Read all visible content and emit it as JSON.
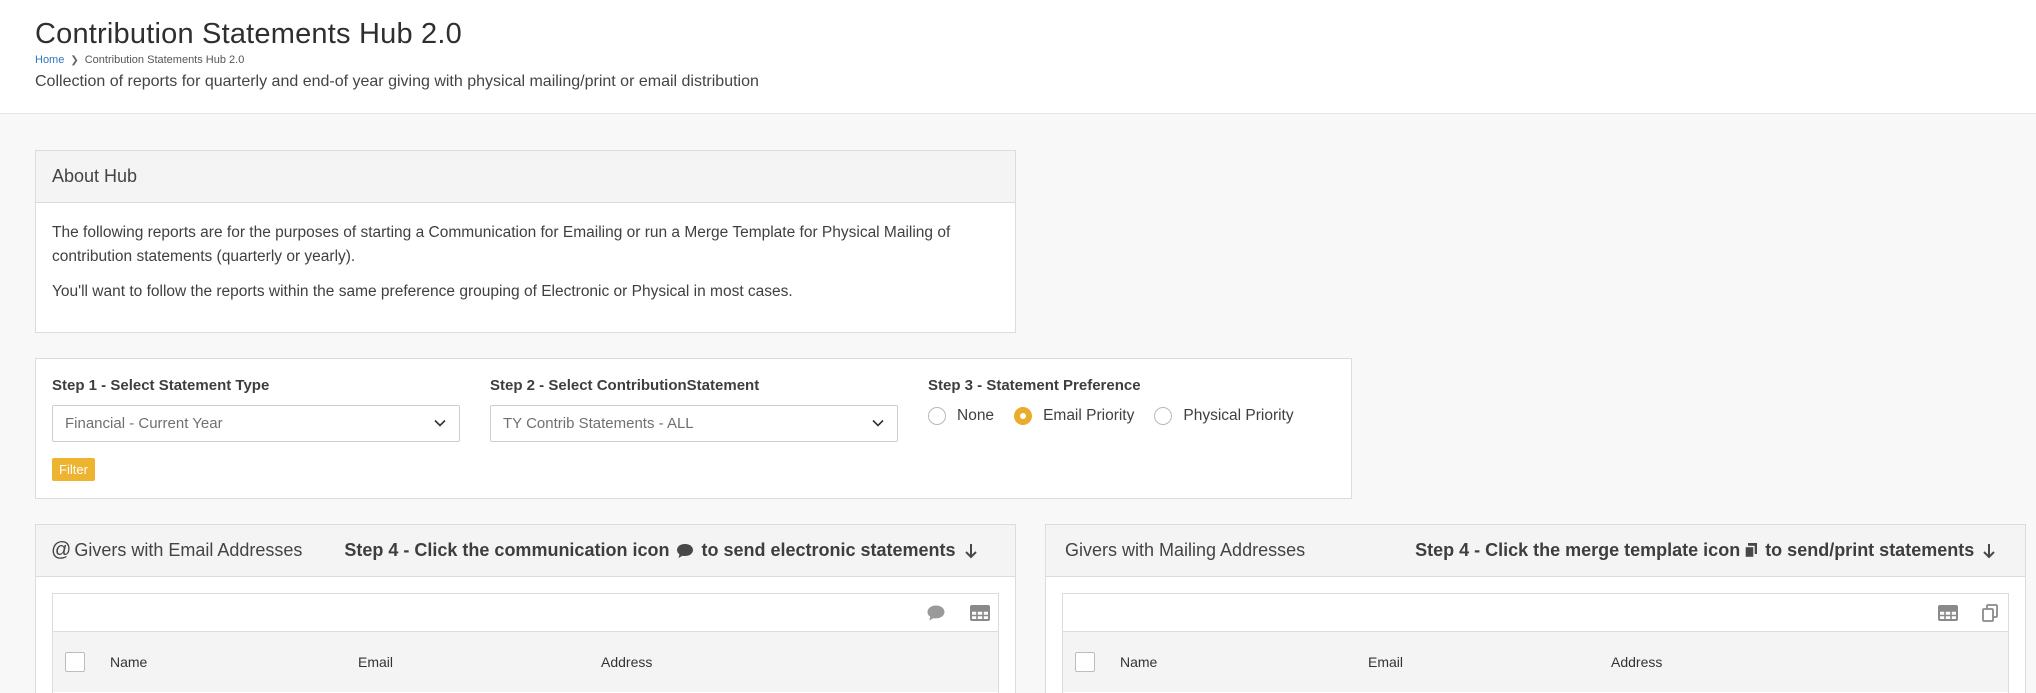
{
  "header": {
    "title": "Contribution Statements Hub 2.0",
    "breadcrumb": [
      "Home",
      "Contribution Statements Hub 2.0"
    ],
    "description": "Collection of reports for quarterly and end-of year giving with physical mailing/print or email distribution"
  },
  "about": {
    "title": "About Hub",
    "paragraphs": [
      "The following reports are for the purposes of starting a Communication for Emailing or run a Merge Template for Physical Mailing of contribution statements (quarterly or yearly).",
      "You'll want to follow the reports within the same preference grouping of Electronic or Physical in most cases."
    ]
  },
  "filters": {
    "step1_label": "Step 1 - Select Statement Type",
    "step1_value": "Financial - Current Year",
    "step2_label": "Step 2 - Select ContributionStatement",
    "step2_value": "TY Contrib Statements - ALL",
    "step3_label": "Step 3 - Statement Preference",
    "preference_options": [
      "None",
      "Email Priority",
      "Physical Priority"
    ],
    "preference_selected": "Email Priority",
    "filter_button": "Filter"
  },
  "email_grid": {
    "title": "Givers with Email Addresses",
    "step_prefix": "Step 4 - Click the communication icon",
    "step_suffix": "to send electronic statements",
    "columns": [
      "Name",
      "Email",
      "Address"
    ],
    "actions": [
      "comment-icon",
      "table-icon"
    ]
  },
  "mail_grid": {
    "title": "Givers with Mailing Addresses",
    "step_prefix": "Step 4 - Click the merge template icon",
    "step_suffix": "to send/print statements",
    "columns": [
      "Name",
      "Email",
      "Address"
    ],
    "actions": [
      "table-icon",
      "copy-icon"
    ]
  },
  "colors": {
    "accent": "#eeb32f",
    "link": "#2f76c2"
  }
}
